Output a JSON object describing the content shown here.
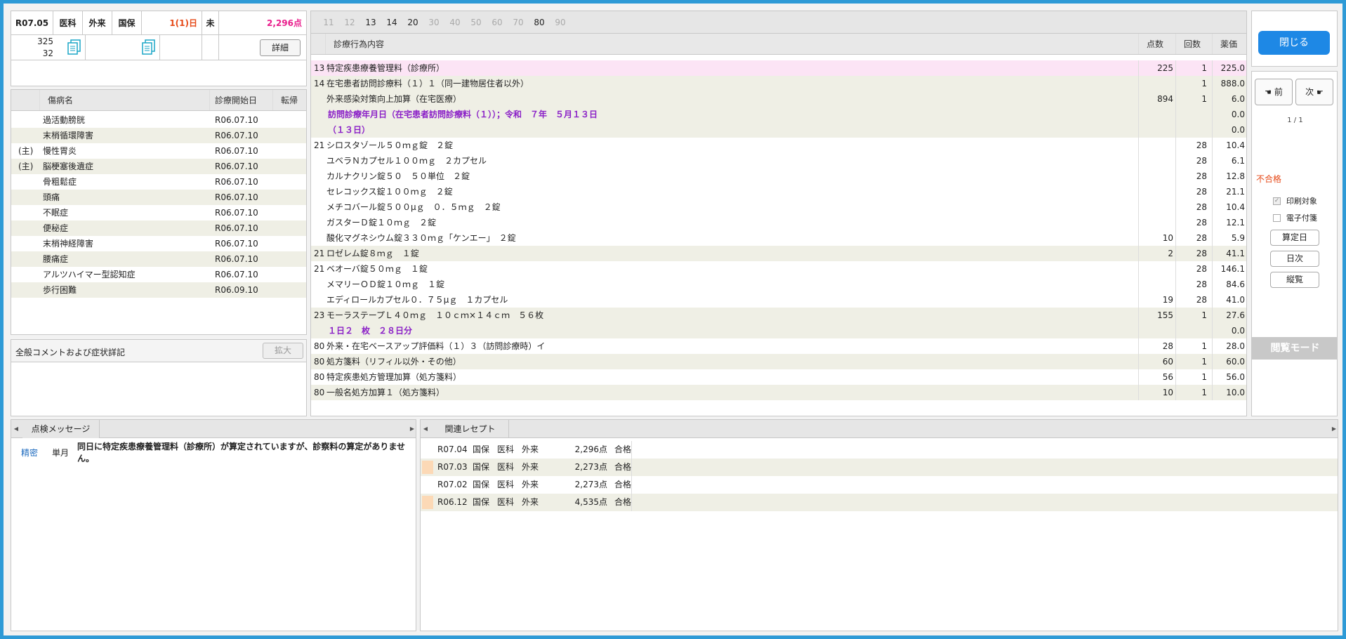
{
  "summary": {
    "period": "R07.05",
    "dept": "医科",
    "type": "外来",
    "insurance": "国保",
    "days": "1(1)日",
    "status": "未",
    "points": "2,296点",
    "num1": "325",
    "num2": "32",
    "detail_btn": "詳細"
  },
  "colors": {
    "accent": "#1e88e5",
    "pink_row": "#fce4f5",
    "band": "#efefe5",
    "red": "#e64a19",
    "purple": "#8a1fc7",
    "orange": "#fcd9b6"
  },
  "disease": {
    "headers": {
      "name": "傷病名",
      "start": "診療開始日",
      "outcome": "転帰"
    },
    "rows": [
      {
        "mark": "",
        "name": "過活動膀胱",
        "date": "R06.07.10"
      },
      {
        "mark": "",
        "name": "末梢循環障害",
        "date": "R06.07.10"
      },
      {
        "mark": "(主)",
        "name": "慢性胃炎",
        "date": "R06.07.10"
      },
      {
        "mark": "(主)",
        "name": "脳梗塞後遺症",
        "date": "R06.07.10"
      },
      {
        "mark": "",
        "name": "骨粗鬆症",
        "date": "R06.07.10"
      },
      {
        "mark": "",
        "name": "頭痛",
        "date": "R06.07.10"
      },
      {
        "mark": "",
        "name": "不眠症",
        "date": "R06.07.10"
      },
      {
        "mark": "",
        "name": "便秘症",
        "date": "R06.07.10"
      },
      {
        "mark": "",
        "name": "末梢神経障害",
        "date": "R06.07.10"
      },
      {
        "mark": "",
        "name": "腰痛症",
        "date": "R06.07.10"
      },
      {
        "mark": "",
        "name": "アルツハイマー型認知症",
        "date": "R06.07.10"
      },
      {
        "mark": "",
        "name": "歩行困難",
        "date": "R06.09.10"
      }
    ]
  },
  "comment": {
    "label": "全般コメントおよび症状詳記",
    "expand_btn": "拡大"
  },
  "tabs": [
    {
      "label": "11",
      "active": false
    },
    {
      "label": "12",
      "active": false
    },
    {
      "label": "13",
      "active": true
    },
    {
      "label": "14",
      "active": true
    },
    {
      "label": "20",
      "active": true
    },
    {
      "label": "30",
      "active": false
    },
    {
      "label": "40",
      "active": false
    },
    {
      "label": "50",
      "active": false
    },
    {
      "label": "60",
      "active": false
    },
    {
      "label": "70",
      "active": false
    },
    {
      "label": "80",
      "active": true
    },
    {
      "label": "90",
      "active": false
    }
  ],
  "treatment": {
    "headers": {
      "content": "診療行為内容",
      "points": "点数",
      "count": "回数",
      "price": "薬価"
    },
    "rows": [
      {
        "code": "13",
        "text": "特定疾患療養管理料（診療所）",
        "points": "225",
        "count": "1",
        "price": "225.0",
        "style": "pink"
      },
      {
        "code": "14",
        "text": "在宅患者訪問診療料（１）１（同一建物居住者以外）",
        "points": "",
        "count": "1",
        "price": "888.0",
        "style": "band"
      },
      {
        "code": "",
        "text": "外来感染対策向上加算（在宅医療）",
        "points": "894",
        "count": "1",
        "price": "6.0",
        "style": "band"
      },
      {
        "code": "",
        "text": "訪問診療年月日（在宅患者訪問診療料（１））；令和　７年　５月１３日",
        "points": "",
        "count": "",
        "price": "0.0",
        "style": "band-purple"
      },
      {
        "code": "",
        "text": "（１３日）",
        "points": "",
        "count": "",
        "price": "0.0",
        "style": "band-purple"
      },
      {
        "code": "21",
        "text": "シロスタゾール５０ｍｇ錠　２錠",
        "points": "",
        "count": "28",
        "price": "10.4",
        "style": ""
      },
      {
        "code": "",
        "text": "ユベラＮカプセル１００ｍｇ　２カプセル",
        "points": "",
        "count": "28",
        "price": "6.1",
        "style": ""
      },
      {
        "code": "",
        "text": "カルナクリン錠５０　５０単位　２錠",
        "points": "",
        "count": "28",
        "price": "12.8",
        "style": ""
      },
      {
        "code": "",
        "text": "セレコックス錠１００ｍｇ　２錠",
        "points": "",
        "count": "28",
        "price": "21.1",
        "style": ""
      },
      {
        "code": "",
        "text": "メチコバール錠５００μｇ　０．５ｍｇ　２錠",
        "points": "",
        "count": "28",
        "price": "10.4",
        "style": ""
      },
      {
        "code": "",
        "text": "ガスターＤ錠１０ｍｇ　２錠",
        "points": "",
        "count": "28",
        "price": "12.1",
        "style": ""
      },
      {
        "code": "",
        "text": "酸化マグネシウム錠３３０ｍｇ「ケンエー」　２錠",
        "points": "10",
        "count": "28",
        "price": "5.9",
        "style": ""
      },
      {
        "code": "21",
        "text": "ロゼレム錠８ｍｇ　１錠",
        "points": "2",
        "count": "28",
        "price": "41.1",
        "style": "band"
      },
      {
        "code": "21",
        "text": "ベオーバ錠５０ｍｇ　１錠",
        "points": "",
        "count": "28",
        "price": "146.1",
        "style": ""
      },
      {
        "code": "",
        "text": "メマリーＯＤ錠１０ｍｇ　１錠",
        "points": "",
        "count": "28",
        "price": "84.6",
        "style": ""
      },
      {
        "code": "",
        "text": "エディロールカプセル０．７５μｇ　１カプセル",
        "points": "19",
        "count": "28",
        "price": "41.0",
        "style": ""
      },
      {
        "code": "23",
        "text": "モーラステープＬ４０ｍｇ　１０ｃｍ×１４ｃｍ　５６枚",
        "points": "155",
        "count": "1",
        "price": "27.6",
        "style": "band"
      },
      {
        "code": "",
        "text": "１日２　枚　２８日分",
        "points": "",
        "count": "",
        "price": "0.0",
        "style": "band-purple"
      },
      {
        "code": "80",
        "text": "外来・在宅ベースアップ評価料（１）３（訪問診療時）イ",
        "points": "28",
        "count": "1",
        "price": "28.0",
        "style": ""
      },
      {
        "code": "80",
        "text": "処方箋料（リフィル以外・その他）",
        "points": "60",
        "count": "1",
        "price": "60.0",
        "style": "band"
      },
      {
        "code": "80",
        "text": "特定疾患処方管理加算（処方箋料）",
        "points": "56",
        "count": "1",
        "price": "56.0",
        "style": ""
      },
      {
        "code": "80",
        "text": "一般名処方加算１（処方箋料）",
        "points": "10",
        "count": "1",
        "price": "10.0",
        "style": "band"
      }
    ]
  },
  "side": {
    "close_btn": "閉じる",
    "prev_btn": "前",
    "next_btn": "次",
    "page": "1 / 1",
    "result": "不合格",
    "print_target": "印刷対象",
    "e_attach": "電子付箋",
    "calc_day_btn": "算定日",
    "daily_btn": "日次",
    "vertical_btn": "縦覧",
    "mode": "閲覧モード"
  },
  "check": {
    "tab": "点検メッセージ",
    "messages": [
      {
        "level": "精密",
        "scope": "単月",
        "text": "同日に特定疾患療養管理料（診療所）が算定されていますが、診察料の算定がありません。"
      }
    ]
  },
  "related": {
    "tab": "関連レセプト",
    "rows": [
      {
        "period": "R07.04",
        "ins": "国保",
        "dept": "医科",
        "type": "外来",
        "points": "2,296点",
        "result": "合格",
        "marked": false
      },
      {
        "period": "R07.03",
        "ins": "国保",
        "dept": "医科",
        "type": "外来",
        "points": "2,273点",
        "result": "合格",
        "marked": true
      },
      {
        "period": "R07.02",
        "ins": "国保",
        "dept": "医科",
        "type": "外来",
        "points": "2,273点",
        "result": "合格",
        "marked": false
      },
      {
        "period": "R06.12",
        "ins": "国保",
        "dept": "医科",
        "type": "外来",
        "points": "4,535点",
        "result": "合格",
        "marked": true
      }
    ]
  }
}
